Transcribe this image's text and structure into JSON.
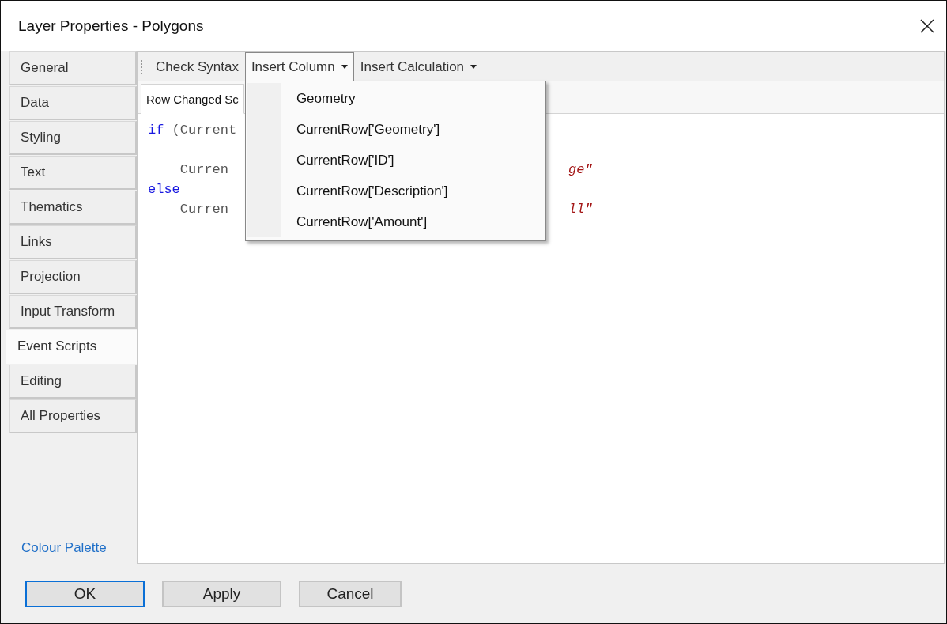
{
  "window": {
    "title": "Layer Properties - Polygons"
  },
  "sidebar": {
    "items": [
      {
        "label": "General",
        "selected": false
      },
      {
        "label": "Data",
        "selected": false
      },
      {
        "label": "Styling",
        "selected": false
      },
      {
        "label": "Text",
        "selected": false
      },
      {
        "label": "Thematics",
        "selected": false
      },
      {
        "label": "Links",
        "selected": false
      },
      {
        "label": "Projection",
        "selected": false
      },
      {
        "label": "Input Transform",
        "selected": false
      },
      {
        "label": "Event Scripts",
        "selected": true
      },
      {
        "label": "Editing",
        "selected": false
      },
      {
        "label": "All Properties",
        "selected": false
      }
    ],
    "link": "Colour Palette"
  },
  "toolbar": {
    "items": [
      {
        "label": "Check Syntax",
        "kind": "button",
        "open": false
      },
      {
        "label": "Insert Column",
        "kind": "dropdown",
        "open": true,
        "menu": [
          "Geometry",
          "CurrentRow['Geometry']",
          "CurrentRow['ID']",
          "CurrentRow['Description']",
          "CurrentRow['Amount']"
        ]
      },
      {
        "label": "Insert Calculation",
        "kind": "dropdown",
        "open": false
      }
    ]
  },
  "editor": {
    "tabs": [
      {
        "label": "Row Changed Sc",
        "selected": true
      }
    ],
    "lines": [
      {
        "kind": "code",
        "left": [
          {
            "text": "if",
            "kind": "keyword"
          },
          {
            "text": " (Current",
            "kind": "plain"
          }
        ]
      },
      {
        "kind": "blank"
      },
      {
        "kind": "code",
        "left": [
          {
            "text": "    Curren",
            "kind": "plain"
          }
        ],
        "right": {
          "text": "ge\"",
          "kind": "string"
        }
      },
      {
        "kind": "code",
        "left": [
          {
            "text": "else",
            "kind": "keyword"
          }
        ]
      },
      {
        "kind": "code",
        "left": [
          {
            "text": "    Curren",
            "kind": "plain"
          }
        ],
        "right": {
          "text": "ll\"",
          "kind": "string"
        }
      }
    ]
  },
  "buttons": [
    {
      "label": "OK",
      "default": true
    },
    {
      "label": "Apply",
      "default": false
    },
    {
      "label": "Cancel",
      "default": false
    }
  ]
}
